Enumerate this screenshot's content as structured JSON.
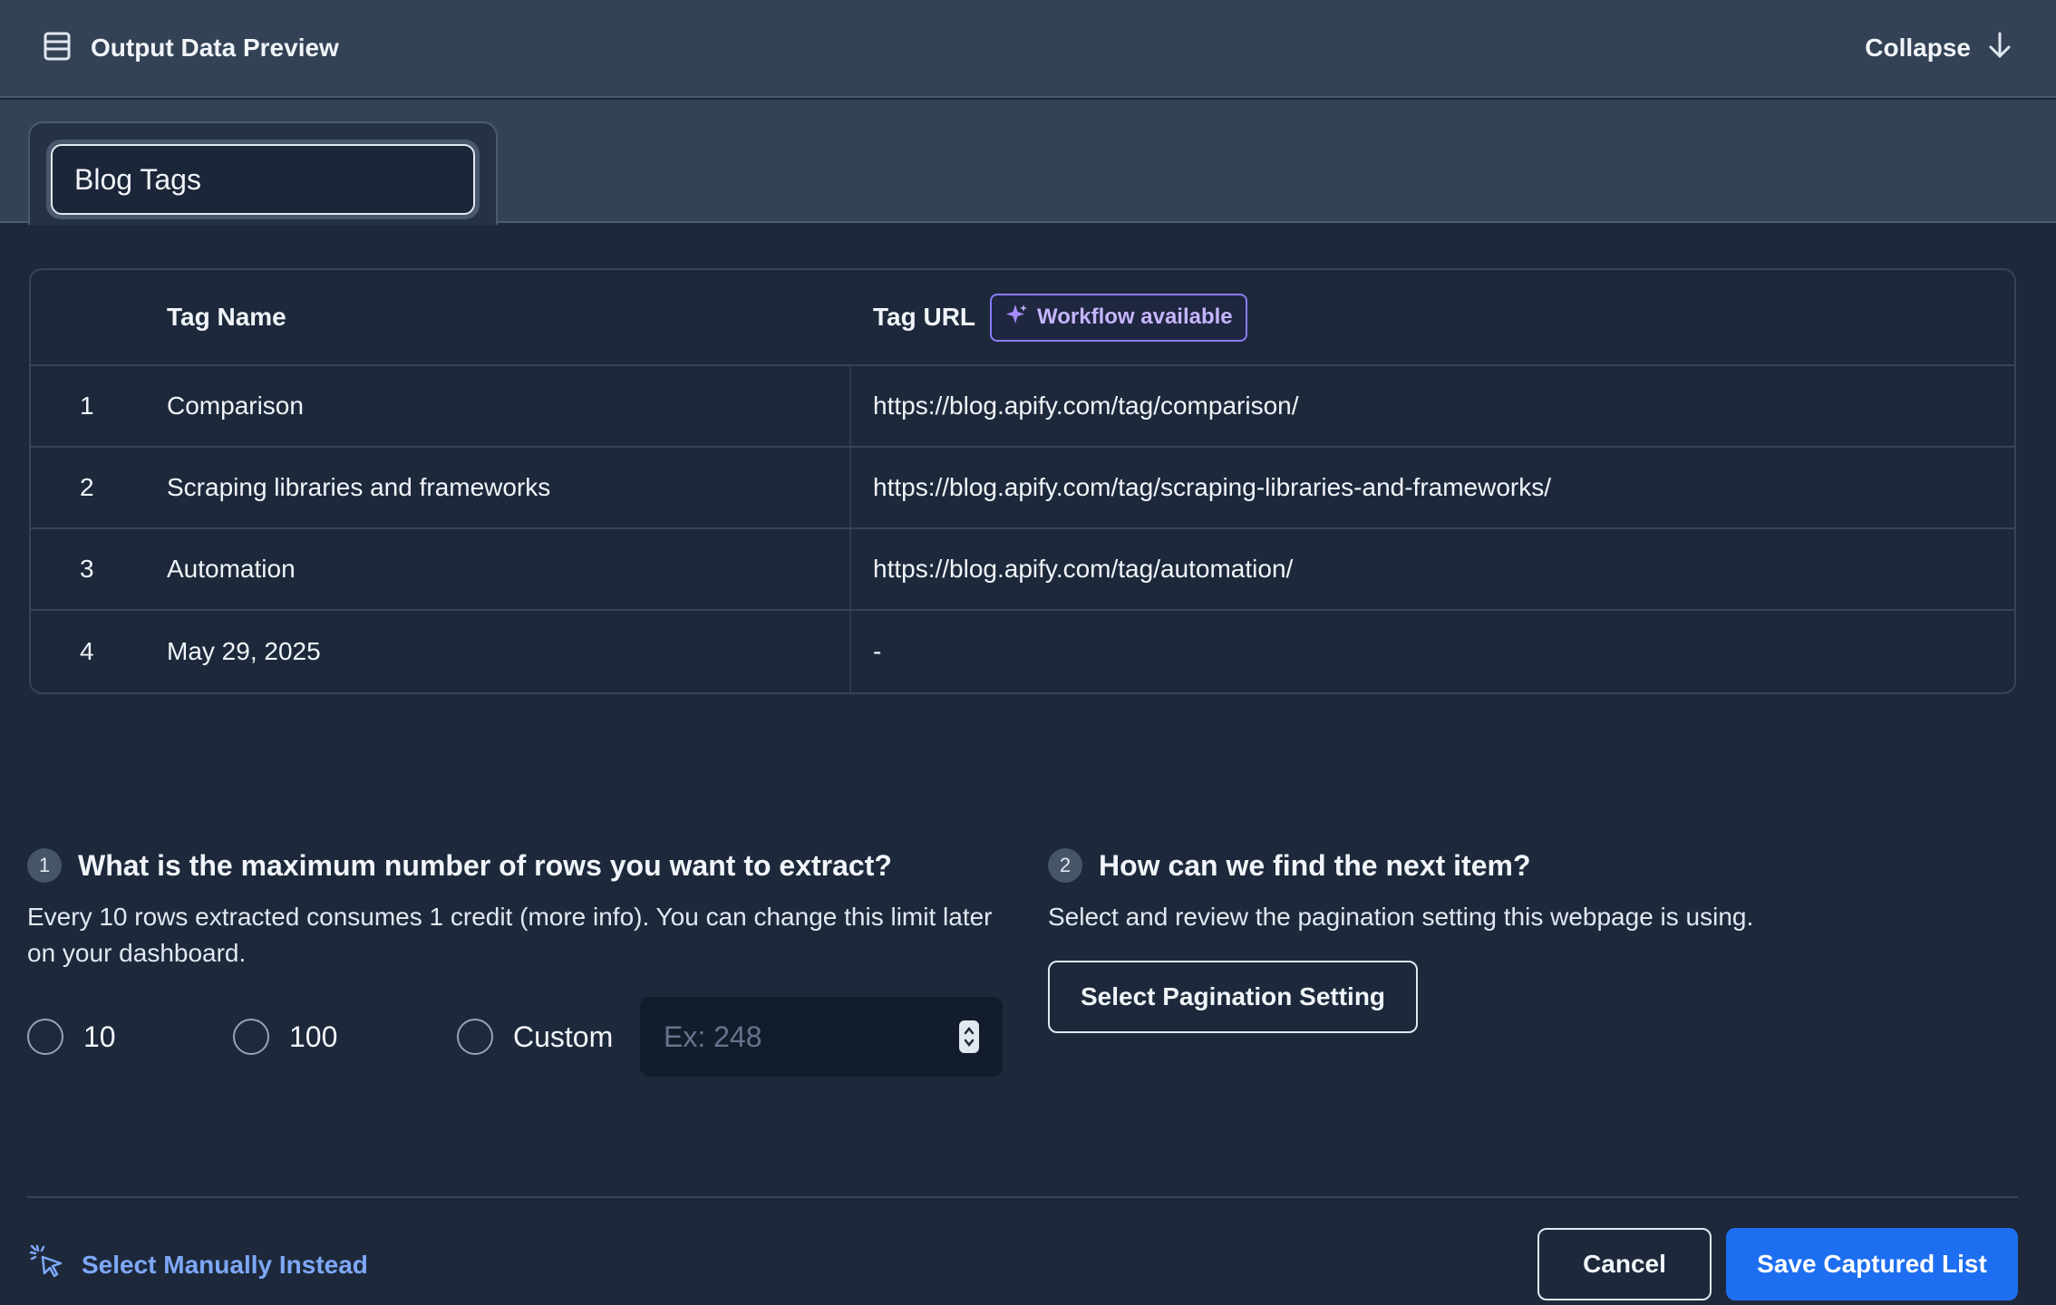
{
  "header": {
    "title": "Output Data Preview",
    "collapse_label": "Collapse"
  },
  "tab": {
    "name_value": "Blog Tags"
  },
  "table": {
    "columns": [
      "Tag Name",
      "Tag URL"
    ],
    "badge": "Workflow available",
    "rows": [
      {
        "index": "1",
        "name": "Comparison",
        "url": "https://blog.apify.com/tag/comparison/"
      },
      {
        "index": "2",
        "name": "Scraping libraries and frameworks",
        "url": "https://blog.apify.com/tag/scraping-libraries-and-frameworks/"
      },
      {
        "index": "3",
        "name": "Automation",
        "url": "https://blog.apify.com/tag/automation/"
      },
      {
        "index": "4",
        "name": "May 29, 2025",
        "url": "-"
      }
    ]
  },
  "question1": {
    "number": "1",
    "title": "What is the maximum number of rows you want to extract?",
    "description": "Every 10 rows extracted consumes 1 credit (more info). You can change this limit later on your dashboard.",
    "options": [
      "10",
      "100",
      "Custom"
    ],
    "custom_placeholder": "Ex: 248"
  },
  "question2": {
    "number": "2",
    "title": "How can we find the next item?",
    "description": "Select and review the pagination setting this webpage is using.",
    "button_label": "Select Pagination Setting"
  },
  "footer": {
    "manual_label": "Select Manually Instead",
    "cancel_label": "Cancel",
    "save_label": "Save Captured List"
  },
  "colors": {
    "background": "#1d293b",
    "header": "#344256",
    "accent": "#1d6ef0",
    "link": "#7ea8f8",
    "badge": "#8b7cf6"
  }
}
